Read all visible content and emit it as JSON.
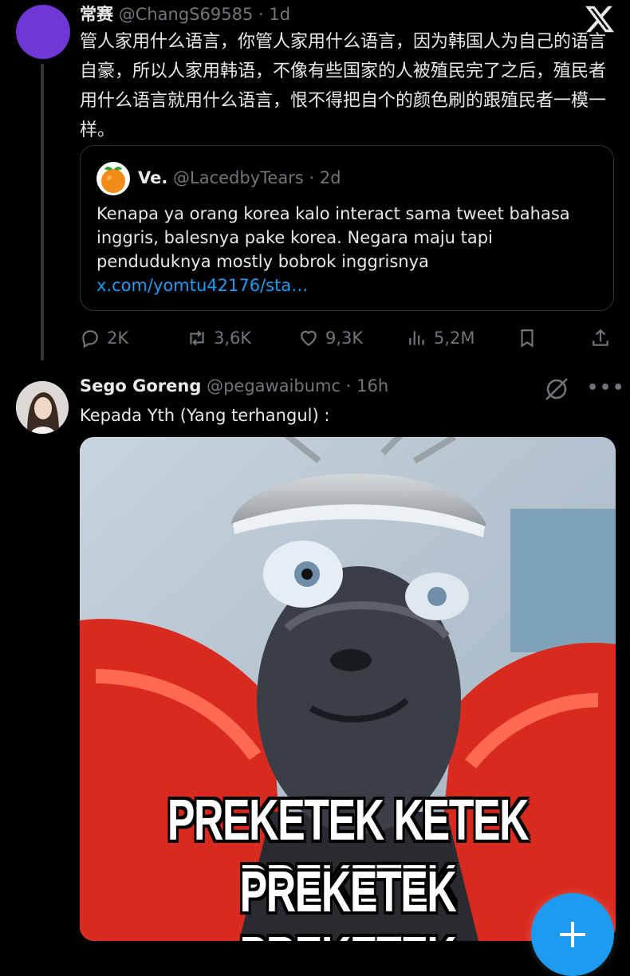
{
  "tweet1": {
    "display_name": "常赛",
    "handle": "@ChangS69585",
    "separator": "·",
    "time": "1d",
    "text": "管人家用什么语言，你管人家用什么语言，因为韩国人为自己的语言自豪，所以人家用韩语，不像有些国家的人被殖民完了之后，殖民者用什么语言就用什么语言，恨不得把自个的颜色刷的跟殖民者一模一样。",
    "avatar_color": "#6f38d6",
    "quote": {
      "display_name": "Ve.",
      "handle": "@LacedbyTears",
      "separator": "·",
      "time": "2d",
      "text": "Kenapa ya orang korea kalo interact sama tweet bahasa inggris, balesnya pake korea. Negara maju tapi penduduknya mostly bobrok inggrisnya ",
      "link_text": "x.com/yomtu42176/sta…",
      "avatar_icon": "orange-icon"
    },
    "actions": {
      "replies": "2K",
      "reposts": "3,6K",
      "likes": "9,3K",
      "views": "5,2M"
    }
  },
  "tweet2": {
    "display_name": "Sego Goreng",
    "handle": "@pegawaibumc",
    "separator": "·",
    "time": "16h",
    "text": "Kepada Yth (Yang terhangul) :",
    "more_label": "•••",
    "media": {
      "caption_line1": "PREKETEK KETEK PREKETEK",
      "caption_line2": "PREKETEK PREKETEK"
    }
  },
  "fab_label": "+",
  "colors": {
    "accent": "#1d9bf0",
    "muted": "#71767b",
    "text": "#e7e9ea",
    "background": "#000000"
  }
}
